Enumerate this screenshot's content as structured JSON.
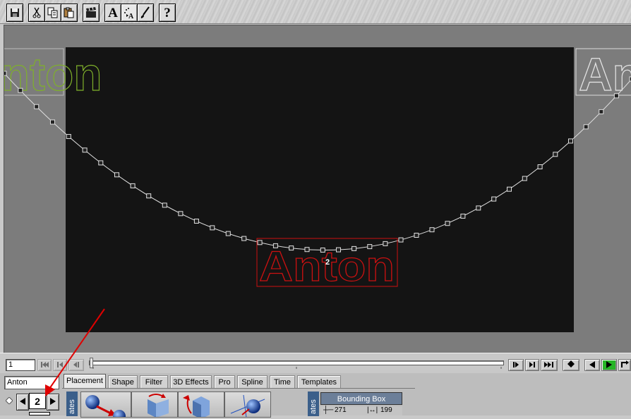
{
  "toolbar": {
    "buttons": [
      {
        "name": "save-icon"
      },
      {
        "name": "cut-icon"
      },
      {
        "name": "copy-icon"
      },
      {
        "name": "paste-icon"
      },
      {
        "name": "clapper-icon"
      },
      {
        "name": "text-tool-button",
        "label": "A"
      },
      {
        "name": "text-path-icon"
      },
      {
        "name": "brush-icon"
      },
      {
        "name": "help-button",
        "label": "?"
      }
    ]
  },
  "stage": {
    "object_label": "2",
    "text": "Anton",
    "start_ghost_text": "Anton",
    "end_ghost_text": "Anton"
  },
  "timeline": {
    "frame_value": "1",
    "slider_position": 0
  },
  "bottom": {
    "object_select": "Anton",
    "object_number": "2",
    "tabs": [
      {
        "label": "Placement",
        "active": true
      },
      {
        "label": "Shape"
      },
      {
        "label": "Filter"
      },
      {
        "label": "3D Effects"
      },
      {
        "label": "Pro"
      },
      {
        "label": "Spline"
      },
      {
        "label": "Time"
      },
      {
        "label": "Templates"
      }
    ],
    "panel_label_left": "ates",
    "panel_label_right": "ates",
    "bounding_box_title": "Bounding Box",
    "bbox_width": "271",
    "bbox_height": "199"
  },
  "colors": {
    "stage_bg": "#141414",
    "selected_outline": "#cc1111",
    "start_ghost": "#7fb02a",
    "path": "#e0e0e0",
    "play_green": "#26b526",
    "annotation_arrow": "#e00000"
  }
}
